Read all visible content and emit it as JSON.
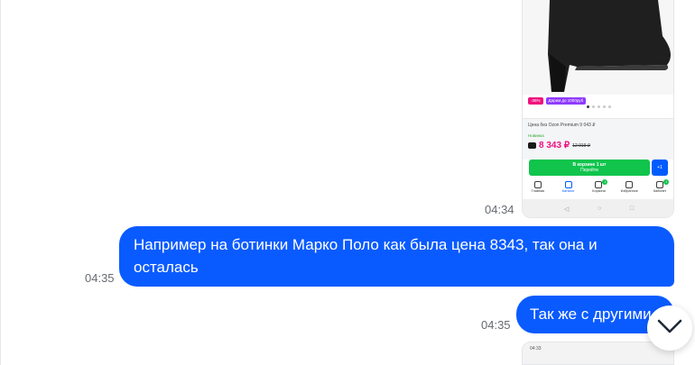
{
  "messages": [
    {
      "type": "image",
      "time": "04:34",
      "screenshot": {
        "badges": [
          {
            "text": "-35%",
            "color": "#f1117e"
          },
          {
            "text": "Дарим до 1000руб",
            "color": "#8f3bff"
          }
        ],
        "ozon_price_line": "Цена без Ozon Premium 9 043 ₽",
        "new_label": "Новинка",
        "price": "8 343 ₽",
        "old_price": "12 919 ₽",
        "cart_button": {
          "line1": "В корзине 1 шт",
          "line2": "Перейти"
        },
        "qty_button": "+1",
        "tabs": [
          {
            "label": "Главная",
            "icon": "home-icon"
          },
          {
            "label": "Каталог",
            "icon": "catalog-icon"
          },
          {
            "label": "Корзина",
            "icon": "cart-icon",
            "count": "1"
          },
          {
            "label": "Избранное",
            "icon": "heart-icon"
          },
          {
            "label": "Кабинет",
            "icon": "profile-icon",
            "count": "1"
          }
        ],
        "system_nav": [
          "◁",
          "○",
          "□"
        ]
      }
    },
    {
      "type": "text",
      "time": "04:35",
      "text": "Например на ботинки Марко Поло как была цена 8343, так она и осталась"
    },
    {
      "type": "text",
      "time": "04:35",
      "text": "Так же с другими"
    },
    {
      "type": "image",
      "screenshot": {
        "status_time": "04:33"
      }
    }
  ],
  "colors": {
    "bubble": "#0a5bff",
    "price": "#f1117e",
    "cart_button": "#10c44c",
    "accent": "#005bff"
  },
  "scroll_button": {
    "icon": "chevron-down-icon"
  }
}
